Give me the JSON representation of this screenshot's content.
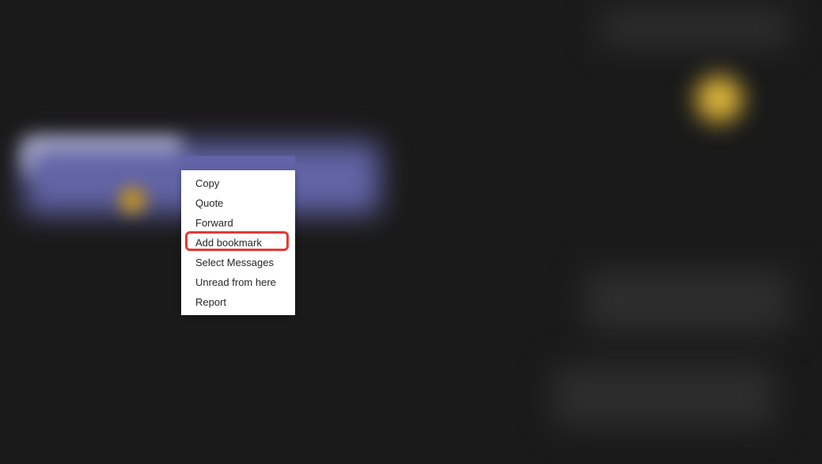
{
  "context_menu": {
    "items": [
      {
        "label": "Copy"
      },
      {
        "label": "Quote"
      },
      {
        "label": "Forward"
      },
      {
        "label": "Add bookmark"
      },
      {
        "label": "Select Messages"
      },
      {
        "label": "Unread from here"
      },
      {
        "label": "Report"
      }
    ]
  },
  "highlight": {
    "color": "#e53935"
  }
}
